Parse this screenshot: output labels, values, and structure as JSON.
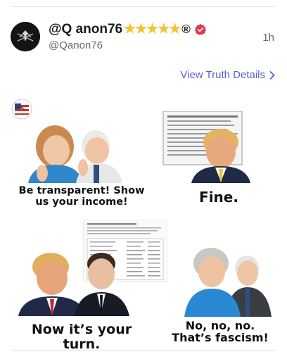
{
  "post": {
    "display_name": "@Q anon76",
    "stars": "★★★★★",
    "registered_mark": "®",
    "handle": "@Qanon76",
    "time": "1h",
    "view_details": "View Truth Details",
    "chevron": "›"
  },
  "meme": {
    "caption_1": "Be transparent! Show us your income!",
    "caption_2": "Fine.",
    "caption_3": "Now it’s your turn.",
    "caption_4": "No, no, no. That’s fascism!"
  },
  "colors": {
    "link": "#5a5fd6",
    "verified": "#e2364a",
    "stars": "#f4c430"
  }
}
